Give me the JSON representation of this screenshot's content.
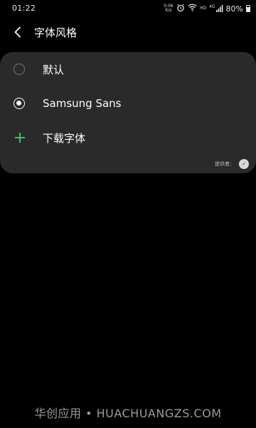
{
  "status_bar": {
    "time": "01:22",
    "network_speed": "0.06 K/s",
    "hd_label": "HD",
    "signal_label": "4G",
    "battery": "80%"
  },
  "header": {
    "title": "字体风格"
  },
  "options": [
    {
      "label": "默认",
      "selected": false
    },
    {
      "label": "Samsung Sans",
      "selected": true
    }
  ],
  "download": {
    "label": "下载字体"
  },
  "provider": {
    "label": "提供者："
  },
  "watermark": "华创应用 • HUACHUANGZS.COM",
  "colors": {
    "background": "#000000",
    "card": "#2a2a2a",
    "accent_green": "#3fbf5f"
  },
  "icons": [
    "back-arrow-icon",
    "alarm-icon",
    "wifi-icon",
    "signal-icon",
    "battery-icon",
    "plus-icon",
    "provider-logo-icon"
  ]
}
